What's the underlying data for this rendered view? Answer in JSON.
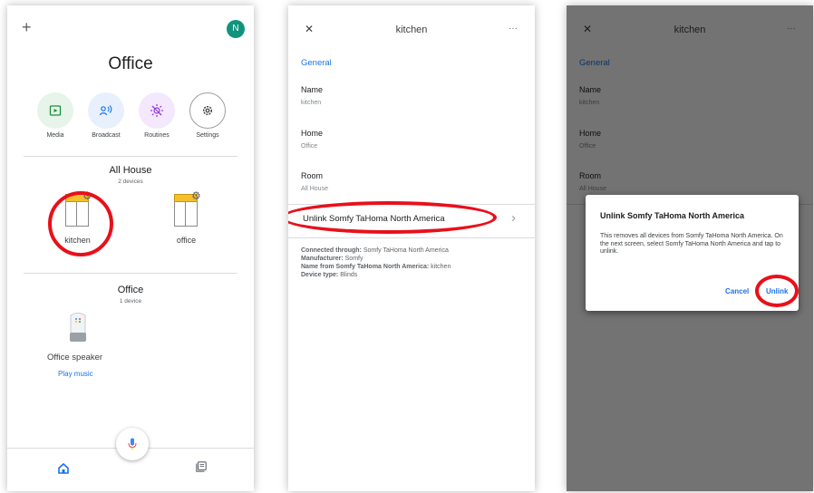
{
  "screen1": {
    "add_glyph": "+",
    "avatar_letter": "N",
    "avatar_color": "#12937e",
    "home_title": "Office",
    "actions": [
      {
        "label": "Media",
        "icon": "media-icon",
        "bg": "#e6f4ea",
        "fg": "#1e8e3e"
      },
      {
        "label": "Broadcast",
        "icon": "broadcast-icon",
        "bg": "#e8f0fe",
        "fg": "#1a73e8"
      },
      {
        "label": "Routines",
        "icon": "routines-icon",
        "bg": "#f3e8fd",
        "fg": "#9334e6"
      },
      {
        "label": "Settings",
        "icon": "settings-icon",
        "bg": "#ffffff",
        "fg": "#5f6368"
      }
    ],
    "group1_title": "All House",
    "group1_count": "2 devices",
    "devices": [
      {
        "label": "kitchen",
        "icon": "blind-icon"
      },
      {
        "label": "office",
        "icon": "blind-icon"
      }
    ],
    "group2_title": "Office",
    "group2_count": "1 device",
    "speaker_label": "Office speaker",
    "speaker_action": "Play music",
    "nav": [
      "home-icon",
      "feed-icon"
    ]
  },
  "screen2": {
    "title": "kitchen",
    "more_glyph": "···",
    "close_glyph": "✕",
    "section": "General",
    "fields": [
      {
        "label": "Name",
        "value": "kitchen"
      },
      {
        "label": "Home",
        "value": "Office"
      },
      {
        "label": "Room",
        "value": "All House"
      }
    ],
    "unlink_label": "Unlink Somfy TaHoma North America",
    "chevron": "›",
    "info": [
      {
        "key": "Connected through:",
        "value": "Somfy TaHoma North America"
      },
      {
        "key": "Manufacturer:",
        "value": "Somfy"
      },
      {
        "key": "Name from Somfy TaHoma North America:",
        "value": "kitchen"
      },
      {
        "key": "Device type:",
        "value": "Blinds"
      }
    ]
  },
  "dialog": {
    "title": "Unlink Somfy TaHoma North America",
    "body": "This removes all devices from Somfy TaHoma North America. On the next screen, select Somfy TaHoma North America and tap to unlink.",
    "cancel": "Cancel",
    "confirm": "Unlink"
  },
  "colors": {
    "accent": "#1a73e8",
    "highlight": "#e8101b",
    "overlay": "rgba(0,0,0,0.55)"
  }
}
